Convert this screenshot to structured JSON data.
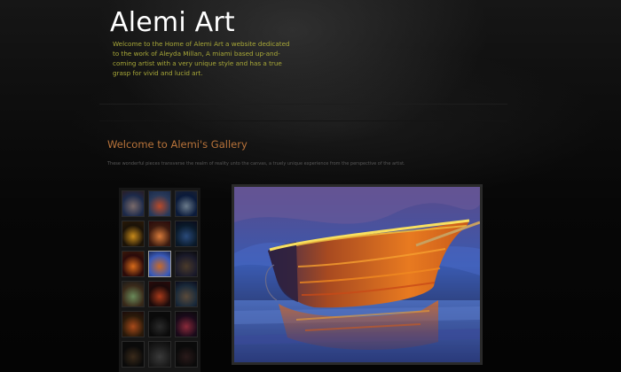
{
  "header": {
    "title": "Alemi Art",
    "intro": "Welcome to the Home of Alemi Art a website dedicated to the work of Aleyda Millan, A miami based up-and-coming artist with a very unique style and has a true grasp for vivid and lucid art."
  },
  "gallery": {
    "heading": "Welcome to Alemi's Gallery",
    "description": "These wonderful pieces transverse the realm of reality unto the canvas, a truely unique experience from the perspective of the artist.",
    "thumbnails": [
      {
        "colors": [
          "#1c2a4a",
          "#7a6a6a",
          "#2a1c24"
        ]
      },
      {
        "colors": [
          "#2a3a5a",
          "#b84a2a",
          "#1a2a4a"
        ]
      },
      {
        "colors": [
          "#0a1a3a",
          "#6a7a8a",
          "#1a2030"
        ]
      },
      {
        "colors": [
          "#1a1208",
          "#c88a1a",
          "#2a1a08"
        ]
      },
      {
        "colors": [
          "#3a1a10",
          "#d87a3a",
          "#2a0a0a"
        ]
      },
      {
        "colors": [
          "#0a1a2a",
          "#2a4a7a",
          "#0a0a1a"
        ]
      },
      {
        "colors": [
          "#2a0a0a",
          "#d86a1a",
          "#3a1a0a"
        ]
      },
      {
        "colors": [
          "#3a5ab8",
          "#c86a2a",
          "#1a2a5a"
        ]
      },
      {
        "colors": [
          "#1a1a2a",
          "#4a3a2a",
          "#0a0a0a"
        ]
      },
      {
        "colors": [
          "#3a2a1a",
          "#6a8a5a",
          "#1a1a1a"
        ]
      },
      {
        "colors": [
          "#1a0a0a",
          "#a83a1a",
          "#2a0a0a"
        ]
      },
      {
        "colors": [
          "#1a2a3a",
          "#5a4a3a",
          "#0a0a1a"
        ]
      },
      {
        "colors": [
          "#2a1a0a",
          "#a84a1a",
          "#1a0a0a"
        ]
      },
      {
        "colors": [
          "#0a0a0a",
          "#2a2a2a",
          "#0a0a0a"
        ]
      },
      {
        "colors": [
          "#1a0a1a",
          "#8a2a3a",
          "#0a0a0a"
        ]
      },
      {
        "colors": [
          "#0a0a0a",
          "#3a2a1a",
          "#0a0a0a"
        ]
      },
      {
        "colors": [
          "#1a1a1a",
          "#3a3a3a",
          "#0a0a0a"
        ]
      },
      {
        "colors": [
          "#0a0a0a",
          "#2a1a1a",
          "#0a0a0a"
        ]
      }
    ],
    "selected_index": 7,
    "featured_alt": "boat-painting"
  },
  "colors": {
    "background": "#040404",
    "title": "#ffffff",
    "intro_text": "#a8a838",
    "heading": "#b8733a",
    "description": "#585858"
  }
}
